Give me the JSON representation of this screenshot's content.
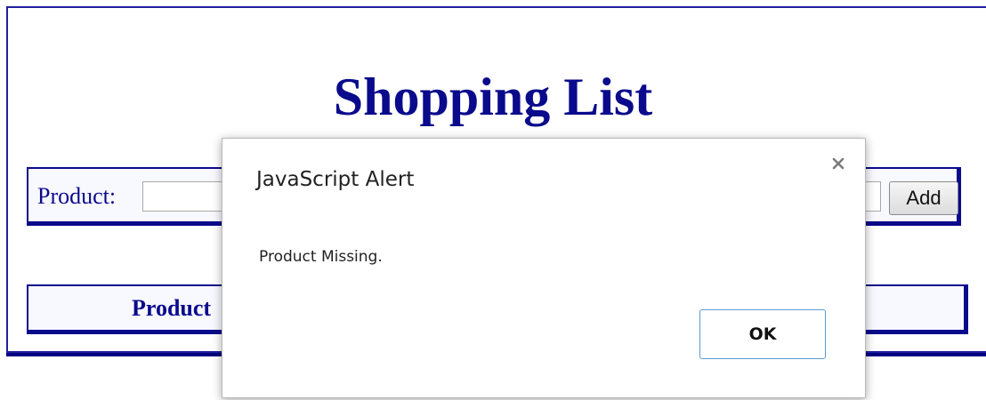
{
  "page": {
    "title": "Shopping List"
  },
  "entry_form": {
    "product_label": "Product:",
    "product_value": "",
    "add_label": "Add"
  },
  "list": {
    "column_product": "Product"
  },
  "alert": {
    "title": "JavaScript Alert",
    "message": "Product Missing.",
    "ok_label": "OK",
    "close_icon": "close-icon"
  },
  "colors": {
    "accent": "#0a0a8c",
    "panel_bg": "#f8f8ff",
    "ok_border": "#5b9bd5"
  }
}
